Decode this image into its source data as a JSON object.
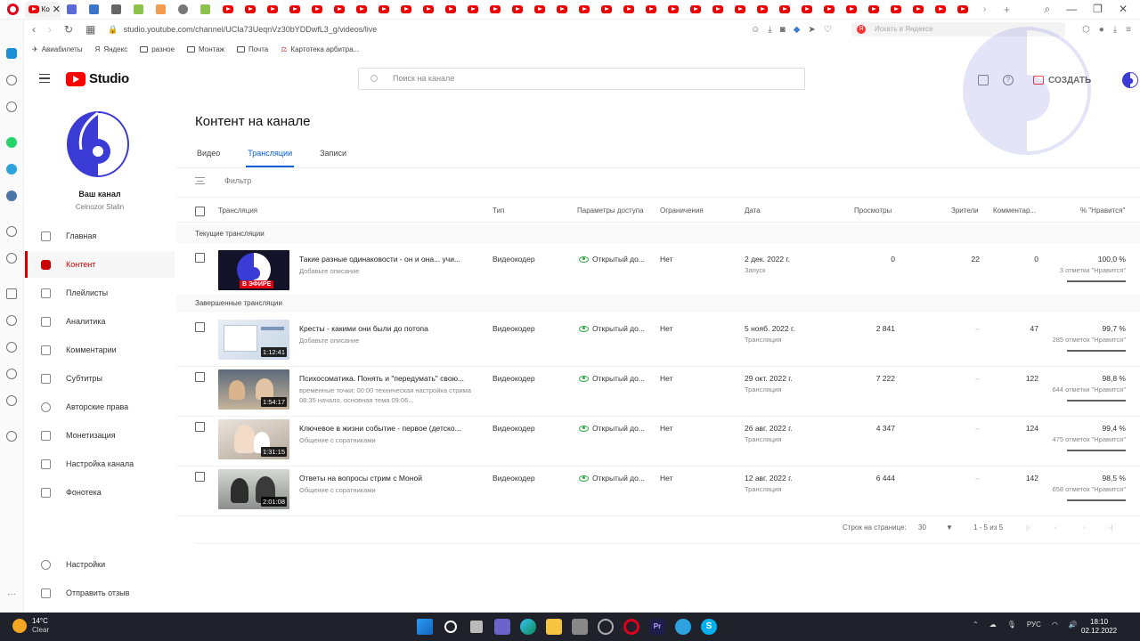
{
  "browser": {
    "url": "studio.youtube.com/channel/UCIa73UeqnVz30bYDDwfL3_g/videos/live",
    "active_tab_label": "Ко",
    "search_placeholder": "Искать в Яндексе",
    "bookmarks": [
      "Авиабилеты",
      "Яндекс",
      "разное",
      "Монтаж",
      "Почта",
      "Картотека арбитра..."
    ]
  },
  "header": {
    "logo_text": "Studio",
    "search_placeholder": "Поиск на канале",
    "create_label": "СОЗДАТЬ"
  },
  "channel": {
    "title": "Ваш канал",
    "name": "Celnozor Stalin"
  },
  "nav": {
    "items": [
      {
        "label": "Главная"
      },
      {
        "label": "Контент"
      },
      {
        "label": "Плейлисты"
      },
      {
        "label": "Аналитика"
      },
      {
        "label": "Комментарии"
      },
      {
        "label": "Субтитры"
      },
      {
        "label": "Авторские права"
      },
      {
        "label": "Монетизация"
      },
      {
        "label": "Настройка канала"
      },
      {
        "label": "Фонотека"
      }
    ],
    "settings": "Настройки",
    "feedback": "Отправить отзыв"
  },
  "main": {
    "title": "Контент на канале",
    "tabs": [
      "Видео",
      "Трансляции",
      "Записи"
    ],
    "filter_label": "Фильтр",
    "columns": {
      "stream": "Трансляция",
      "type": "Тип",
      "visibility": "Параметры доступа",
      "restrictions": "Ограничения",
      "date": "Дата",
      "views": "Просмотры",
      "viewers": "Зрители",
      "comments": "Комментар...",
      "likes": "% \"Нравится\""
    },
    "current_section": "Текущие трансляции",
    "completed_section": "Завершенные трансляции",
    "live_badge": "В ЭФИРЕ",
    "current": [
      {
        "title": "Такие разные одинаковости - он и она... учи...",
        "desc": "Добавьте описание",
        "type": "Видеокодер",
        "visibility": "Открытый до...",
        "restrictions": "Нет",
        "date": "2 дек. 2022 г.",
        "date_sub": "Запуск",
        "views": "0",
        "viewers": "22",
        "comments": "0",
        "likes": "100,0 %",
        "likes_sub": "3 отметки \"Нравится\""
      }
    ],
    "completed": [
      {
        "title": "Кресты - какими они были до потопа",
        "desc": "Добавьте описание",
        "duration": "1:12:41",
        "type": "Видеокодер",
        "visibility": "Открытый до...",
        "restrictions": "Нет",
        "date": "5 нояб. 2022 г.",
        "date_sub": "Трансляция",
        "views": "2 841",
        "viewers": "–",
        "comments": "47",
        "likes": "99,7 %",
        "likes_sub": "285 отметок \"Нравится\""
      },
      {
        "title": "Психосоматика. Понять и \"передумать\" свою...",
        "desc": "временные точки: 00:00 техническая настройка стрима 08:35 начало, основная тема 09:06...",
        "duration": "1:54:17",
        "type": "Видеокодер",
        "visibility": "Открытый до...",
        "restrictions": "Нет",
        "date": "29 окт. 2022 г.",
        "date_sub": "Трансляция",
        "views": "7 222",
        "viewers": "–",
        "comments": "122",
        "likes": "98,8 %",
        "likes_sub": "644 отметки \"Нравится\""
      },
      {
        "title": "Ключевое в жизни событие - первое (детско...",
        "desc": "Общение с соратниками",
        "duration": "1:31:15",
        "type": "Видеокодер",
        "visibility": "Открытый до...",
        "restrictions": "Нет",
        "date": "26 авг. 2022 г.",
        "date_sub": "Трансляция",
        "views": "4 347",
        "viewers": "–",
        "comments": "124",
        "likes": "99,4 %",
        "likes_sub": "475 отметок \"Нравится\""
      },
      {
        "title": "Ответы на вопросы стрим с Моной",
        "desc": "Общение с соратниками",
        "duration": "2:01:08",
        "type": "Видеокодер",
        "visibility": "Открытый до...",
        "restrictions": "Нет",
        "date": "12 авг. 2022 г.",
        "date_sub": "Трансляция",
        "views": "6 444",
        "viewers": "–",
        "comments": "142",
        "likes": "98,5 %",
        "likes_sub": "658 отметок \"Нравится\""
      }
    ],
    "pagination": {
      "rows_label": "Строк на странице:",
      "rows_value": "30",
      "range": "1 - 5 из 5"
    }
  },
  "taskbar": {
    "temperature": "14°C",
    "weather": "Clear",
    "language": "РУС",
    "time": "18:10",
    "date": "02.12.2022"
  },
  "colors": {
    "accent_red": "#cc0000",
    "link_blue": "#065fd4",
    "public_green": "#2ba640",
    "brand_purple": "#3b3bd6"
  }
}
